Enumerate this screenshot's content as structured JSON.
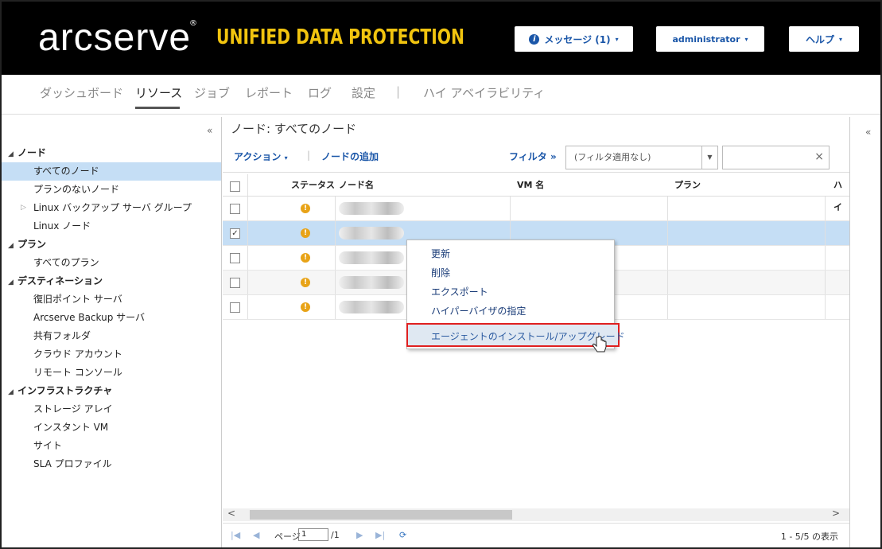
{
  "header": {
    "logo_text": "arcserve",
    "logo_reg": "®",
    "logo_tagline": "UNIFIED DATA PROTECTION",
    "messages_label": "メッセージ (1)",
    "messages_icon": "info-icon",
    "user_label": "administrator",
    "help_label": "ヘルプ",
    "dropdown_icon": "▾"
  },
  "nav": {
    "items": [
      "ダッシュボード",
      "リソース",
      "ジョブ",
      "レポート",
      "ログ",
      "設定"
    ],
    "separator": "|",
    "ha_label": "ハイ アベイラビリティ",
    "active": "リソース"
  },
  "sidebar": {
    "collapse_icon": "«",
    "groups": [
      {
        "label": "ノード",
        "children": [
          "すべてのノード",
          "プランのないノード",
          "Linux バックアップ サーバ グループ",
          "Linux ノード"
        ]
      },
      {
        "label": "プラン",
        "children": [
          "すべてのプラン"
        ]
      },
      {
        "label": "デスティネーション",
        "children": [
          "復旧ポイント サーバ",
          "Arcserve Backup サーバ",
          "共有フォルダ",
          "クラウド アカウント",
          "リモート コンソール"
        ]
      },
      {
        "label": "インフラストラクチャ",
        "children": [
          "ストレージ アレイ",
          "インスタント VM",
          "サイト",
          "SLA プロファイル"
        ]
      }
    ],
    "selected": "すべてのノード"
  },
  "main": {
    "title": "ノード: すべてのノード",
    "toolbar": {
      "action_label": "アクション",
      "action_dd": "▾",
      "separator": "|",
      "add_node_label": "ノードの追加",
      "filter_label": "フィルタ",
      "filter_icon": "»",
      "filter_select_value": "(フィルタ適用なし)",
      "filter_clear": "×"
    },
    "columns": [
      "ステータス",
      "ノード名",
      "VM 名",
      "プラン",
      "ハイ"
    ],
    "rows": [
      {
        "checked": false,
        "status": "warning"
      },
      {
        "checked": true,
        "status": "warning"
      },
      {
        "checked": false,
        "status": "warning"
      },
      {
        "checked": false,
        "status": "warning"
      },
      {
        "checked": false,
        "status": "warning"
      }
    ],
    "context_menu": [
      "更新",
      "削除",
      "エクスポート",
      "ハイパーバイザの指定",
      "エージェントのインストール/アップグレード"
    ],
    "pager": {
      "page_label": "ページ",
      "page_value": "1",
      "page_total": "/1",
      "count_text": "1 - 5/5 の表示"
    }
  },
  "right_panel": {
    "collapse_icon": "«"
  }
}
